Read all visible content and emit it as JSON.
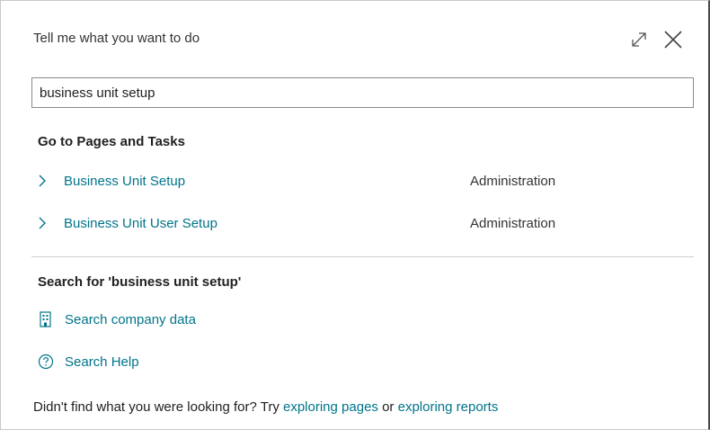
{
  "dialog": {
    "title": "Tell me what you want to do",
    "search_value": "business unit setup"
  },
  "pages_section": {
    "heading": "Go to Pages and Tasks",
    "results": [
      {
        "label": "Business Unit Setup",
        "category": "Administration"
      },
      {
        "label": "Business Unit User Setup",
        "category": "Administration"
      }
    ]
  },
  "search_section": {
    "heading": "Search for 'business unit setup'",
    "actions": [
      {
        "label": "Search company data",
        "icon": "building-icon"
      },
      {
        "label": "Search Help",
        "icon": "help-circle-icon"
      }
    ]
  },
  "footer": {
    "prefix": "Didn't find what you were looking for? Try ",
    "link1": "exploring pages",
    "middle": " or ",
    "link2": "exploring reports"
  },
  "colors": {
    "link": "#00748a",
    "text": "#212121"
  }
}
